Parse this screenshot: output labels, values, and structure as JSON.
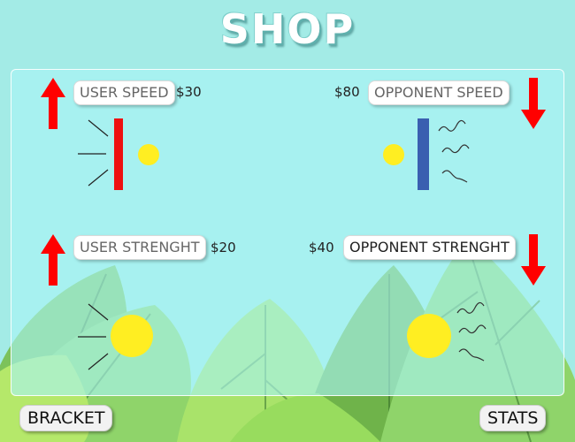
{
  "title": "SHOP",
  "upgrades": {
    "user_speed": {
      "label": "USER SPEED",
      "price": "$30"
    },
    "opponent_speed": {
      "label": "OPPONENT SPEED",
      "price": "$80"
    },
    "user_strength": {
      "label": "USER STRENGHT",
      "price": "$20"
    },
    "opponent_strength": {
      "label": "OPPONENT STRENGHT",
      "price": "$40"
    }
  },
  "buttons": {
    "bracket": "BRACKET",
    "stats": "STATS"
  },
  "icons": {
    "up": "red-up-arrow-icon",
    "down": "red-down-arrow-icon",
    "fast": "fast-paddle-ball-icon",
    "slow": "slow-paddle-ball-icon",
    "strong": "strong-ball-icon",
    "weak": "weak-ball-icon"
  },
  "colors": {
    "background": "#a3ebe6",
    "arrow": "#ff0000",
    "user_paddle": "#ee1111",
    "opponent_paddle": "#3a5fb0",
    "ball": "#ffee22"
  }
}
